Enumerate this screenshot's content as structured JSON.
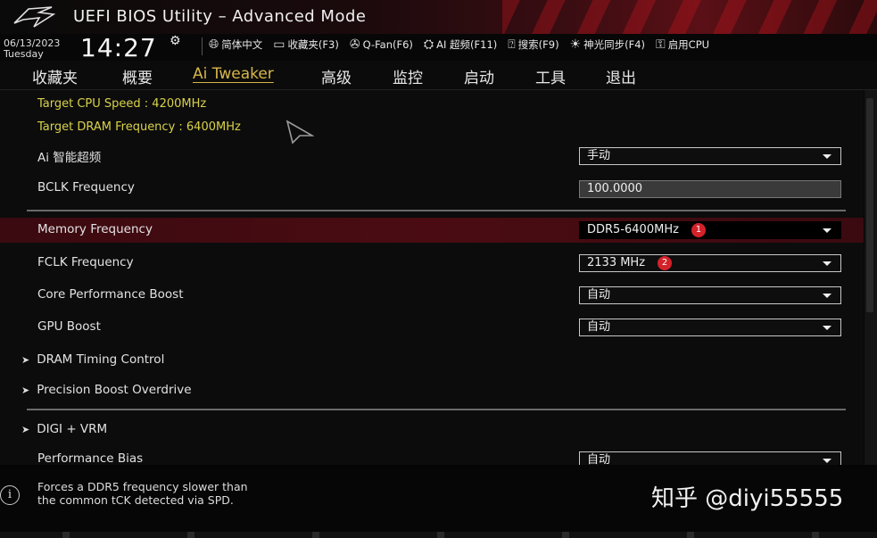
{
  "window": {
    "title": "UEFI BIOS Utility – Advanced Mode"
  },
  "header": {
    "date": "06/13/2023",
    "weekday": "Tuesday",
    "time": "14:27",
    "tools": [
      {
        "icon": "globe-icon",
        "label": "简体中文"
      },
      {
        "icon": "favorites-icon",
        "label": "收藏夹(F3)"
      },
      {
        "icon": "fan-icon",
        "label": "Q-Fan(F6)"
      },
      {
        "icon": "ai-overclock-icon",
        "label": "AI 超频(F11)"
      },
      {
        "icon": "search-help-icon",
        "label": "搜索(F9)"
      },
      {
        "icon": "aura-light-icon",
        "label": "神光同步(F4)"
      },
      {
        "icon": "cpu-boot-icon",
        "label": "启用CPU"
      }
    ]
  },
  "tabs": [
    {
      "label": "收藏夹"
    },
    {
      "label": "概要"
    },
    {
      "label": "Ai Tweaker",
      "active": true
    },
    {
      "label": "高级"
    },
    {
      "label": "监控"
    },
    {
      "label": "启动"
    },
    {
      "label": "工具"
    },
    {
      "label": "退出"
    }
  ],
  "info_lines": [
    "Target CPU Speed : 4200MHz",
    "Target DRAM Frequency : 6400MHz"
  ],
  "settings": {
    "ai_oc": {
      "label": "Ai 智能超频",
      "value": "手动"
    },
    "bclk": {
      "label": "BCLK Frequency",
      "value": "100.0000"
    },
    "memory_freq": {
      "label": "Memory Frequency",
      "value": "DDR5-6400MHz",
      "badge": "1"
    },
    "fclk": {
      "label": "FCLK Frequency",
      "value": "2133 MHz",
      "badge": "2"
    },
    "cpb": {
      "label": "Core Performance Boost",
      "value": "自动"
    },
    "gpu_boost": {
      "label": "GPU Boost",
      "value": "自动"
    },
    "perf_bias": {
      "label": "Performance Bias",
      "value": "自动"
    }
  },
  "submenus": {
    "dram_timing": "DRAM Timing Control",
    "pbo": "Precision Boost Overdrive",
    "digi_vrm": "DIGI + VRM"
  },
  "help_text": {
    "line1": "Forces a DDR5 frequency slower than",
    "line2": "the common tCK detected via SPD."
  },
  "watermark": "知乎 @diyi55555",
  "colors": {
    "accent_gold": "#d7b74a",
    "info_yellow": "#d9d24a",
    "highlight_red": "#4a0c12",
    "badge_red": "#d4222a"
  }
}
